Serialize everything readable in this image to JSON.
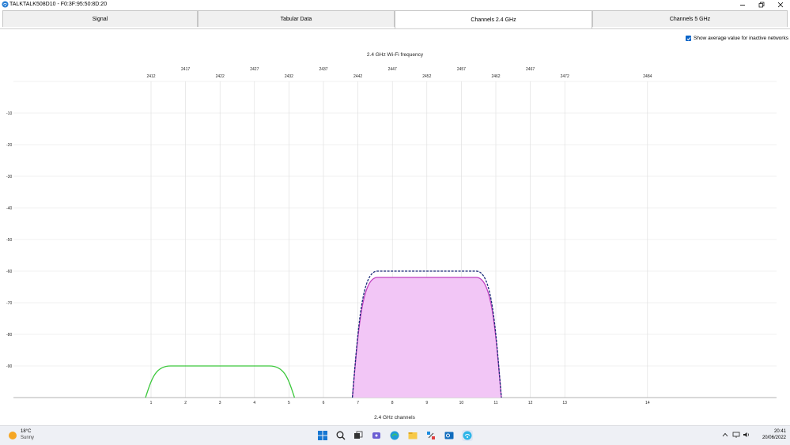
{
  "window": {
    "title": "TALKTALK508D10 - F0:3F:95:50:8D:20"
  },
  "tabs": [
    {
      "label": "Signal",
      "active": false
    },
    {
      "label": "Tabular Data",
      "active": false
    },
    {
      "label": "Channels 2.4 GHz",
      "active": true
    },
    {
      "label": "Channels 5 GHz",
      "active": false
    }
  ],
  "options": {
    "show_average_label": "Show average value for inactive networks",
    "show_average_checked": true
  },
  "chart_data": {
    "type": "area",
    "title": "2.4 GHz Wi-Fi frequency",
    "xlabel": "2.4 GHz channels",
    "ylabel": "",
    "channels": [
      "1",
      "2",
      "3",
      "4",
      "5",
      "6",
      "7",
      "8",
      "9",
      "10",
      "11",
      "12",
      "13",
      "14"
    ],
    "channel_freqs": [
      2412,
      2417,
      2422,
      2427,
      2432,
      2437,
      2442,
      2447,
      2452,
      2457,
      2462,
      2467,
      2472,
      2484
    ],
    "freq_labels": [
      "2412",
      "2417",
      "2422",
      "2427",
      "2432",
      "2437",
      "2442",
      "2447",
      "2452",
      "2457",
      "2462",
      "2467",
      "2472",
      "2484"
    ],
    "y_ticks": [
      "-10",
      "-20",
      "-30",
      "-40",
      "-50",
      "-60",
      "-70",
      "-80",
      "-90"
    ],
    "ylim": [
      -100,
      0
    ],
    "grid": true,
    "series": [
      {
        "center_channel": 3,
        "span_channels": [
          1,
          5
        ],
        "level": -90,
        "color": "#3cc83c",
        "fill": "none",
        "dashed": false
      },
      {
        "center_channel": 9,
        "span_channels": [
          7,
          11
        ],
        "level": -62,
        "color": "#c040c0",
        "fill": "#f2c6f6",
        "dashed": false
      },
      {
        "center_channel": 9,
        "span_channels": [
          7,
          11
        ],
        "level": -60,
        "color": "#1a2a78",
        "fill": "none",
        "dashed": true
      }
    ]
  },
  "taskbar": {
    "weather_temp": "18°C",
    "weather_cond": "Sunny",
    "time": "20:41",
    "date": "20/06/2022"
  }
}
